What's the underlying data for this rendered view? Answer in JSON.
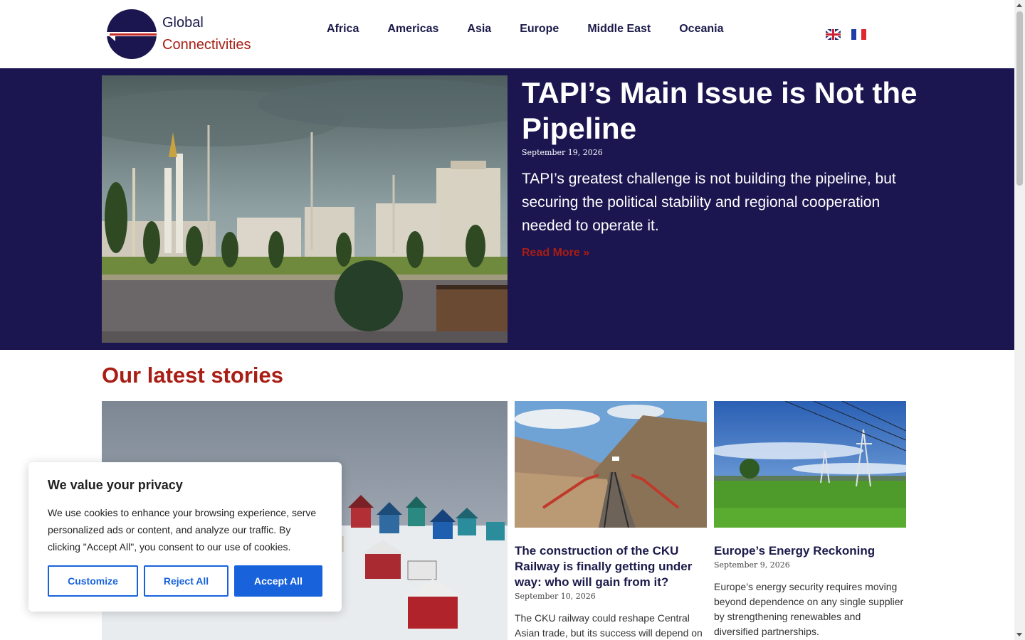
{
  "brand": {
    "line1": "Global",
    "line2": "Connectivities"
  },
  "nav": {
    "items": [
      "Africa",
      "Americas",
      "Asia",
      "Europe",
      "Middle East",
      "Oceania"
    ]
  },
  "languages": [
    "English",
    "Français"
  ],
  "hero": {
    "title": "TAPI’s Main Issue is Not the Pipeline",
    "date": "September 19, 2026",
    "excerpt": "TAPI’s greatest challenge is not building the pipeline, but securing the political stability and regional cooperation needed to operate it.",
    "read_more": "Read More »"
  },
  "latest": {
    "heading": "Our latest stories",
    "cards": [
      {
        "title": "The construction of the CKU Railway is finally getting under way: who will gain from it?",
        "date": "September 10, 2026",
        "excerpt": "The CKU railway could reshape Central Asian trade, but its success will depend on"
      },
      {
        "title": "Europe’s Energy Reckoning",
        "date": "September 9, 2026",
        "excerpt": "Europe’s energy security requires moving beyond dependence on any single supplier by strengthening renewables and diversified partnerships."
      }
    ]
  },
  "cookie": {
    "title": "We value your privacy",
    "text": "We use cookies to enhance your browsing experience, serve personalized ads or content, and analyze our traffic. By clicking \"Accept All\", you consent to our use of cookies.",
    "customize": "Customize",
    "reject": "Reject All",
    "accept": "Accept All"
  },
  "colors": {
    "navy": "#1b1650",
    "brand_red": "#a81d14",
    "cookie_blue": "#1863dc"
  }
}
